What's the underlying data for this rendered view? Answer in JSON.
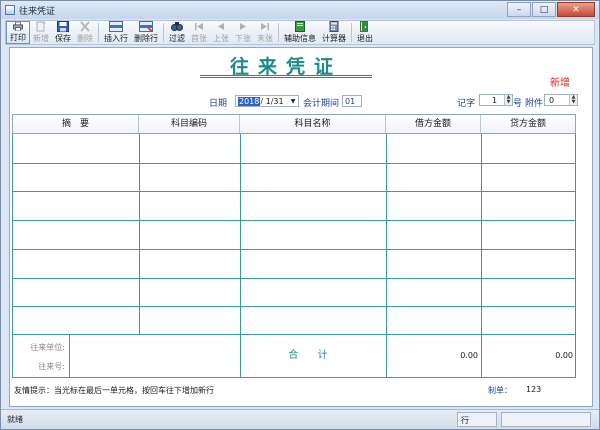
{
  "window": {
    "title": "往来凭证",
    "minimize": "–",
    "maximize": "□",
    "close": "✕"
  },
  "toolbar": {
    "buttons": [
      {
        "label": "打印",
        "icon": "print-icon",
        "state": "active"
      },
      {
        "label": "新增",
        "icon": "new-icon",
        "state": "disabled"
      },
      {
        "label": "保存",
        "icon": "save-icon",
        "state": "enabled"
      },
      {
        "label": "删除",
        "icon": "delete-icon",
        "state": "disabled"
      },
      {
        "label": "插入行",
        "icon": "insert-row-icon",
        "state": "enabled"
      },
      {
        "label": "删除行",
        "icon": "delete-row-icon",
        "state": "enabled"
      },
      {
        "label": "过滤",
        "icon": "filter-icon",
        "state": "enabled"
      },
      {
        "label": "首张",
        "icon": "first-icon",
        "state": "disabled"
      },
      {
        "label": "上张",
        "icon": "prev-icon",
        "state": "disabled"
      },
      {
        "label": "下张",
        "icon": "next-icon",
        "state": "disabled"
      },
      {
        "label": "末张",
        "icon": "last-icon",
        "state": "disabled"
      },
      {
        "label": "辅助信息",
        "icon": "aux-info-icon",
        "state": "enabled"
      },
      {
        "label": "计算器",
        "icon": "calculator-icon",
        "state": "enabled"
      },
      {
        "label": "退出",
        "icon": "exit-icon",
        "state": "enabled"
      }
    ]
  },
  "voucher": {
    "title": "往来凭证",
    "status": "新增",
    "date_label": "日期",
    "date_year": "2018",
    "date_rest": "/ 1/31",
    "period_label": "会计期间",
    "period_value": "01",
    "mark_label": "记字",
    "mark_value": "1",
    "number_label": "号",
    "attachment_label": "附件",
    "attachment_value": "0"
  },
  "grid": {
    "columns": [
      "摘　要",
      "科目编码",
      "科目名称",
      "借方金额",
      "贷方金额"
    ],
    "rows": [
      [
        "",
        "",
        "",
        "",
        ""
      ],
      [
        "",
        "",
        "",
        "",
        ""
      ],
      [
        "",
        "",
        "",
        "",
        ""
      ],
      [
        "",
        "",
        "",
        "",
        ""
      ],
      [
        "",
        "",
        "",
        "",
        ""
      ],
      [
        "",
        "",
        "",
        "",
        ""
      ],
      [
        "",
        "",
        "",
        "",
        ""
      ]
    ]
  },
  "totals": {
    "partner_unit_label": "往来单位:",
    "partner_no_label": "往来号:",
    "total_label": "合 计",
    "debit_total": "0.00",
    "credit_total": "0.00"
  },
  "footer": {
    "tip": "友情提示：当光标在最后一单元格，按回车往下增加新行",
    "maker_label": "制单：",
    "maker_value": "123"
  },
  "statusbar": {
    "left": "就绪",
    "panel": "行"
  }
}
